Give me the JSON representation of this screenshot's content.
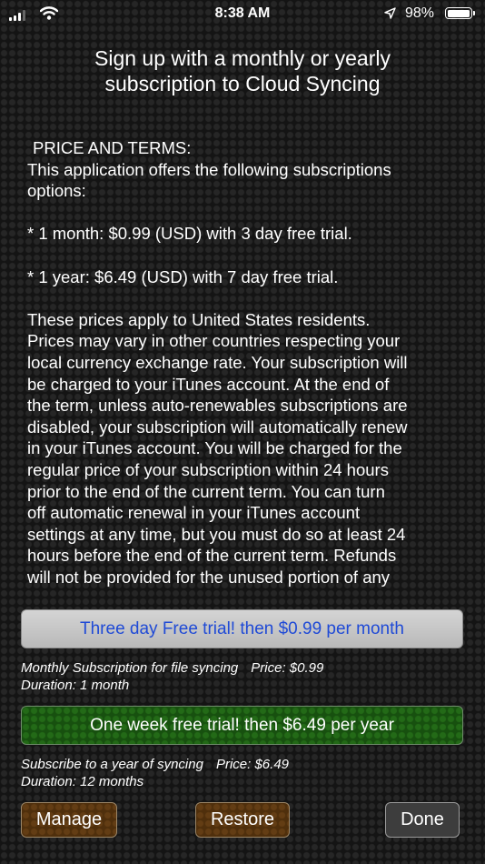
{
  "status_bar": {
    "time": "8:38 AM",
    "battery_percent": "98%",
    "battery_level": 0.98,
    "signal_bars": 4,
    "signal_bars_active": 3,
    "icons": [
      "signal-icon",
      "wifi-icon",
      "location-arrow-icon",
      "battery-icon"
    ]
  },
  "header": {
    "title_line1": "Sign up with a monthly or yearly",
    "title_line2": "subscription to Cloud Syncing"
  },
  "terms": {
    "heading": "PRICE AND TERMS:",
    "intro_line1": "This application offers the following subscriptions",
    "intro_line2": "options:",
    "option_month": "* 1 month: $0.99 (USD) with 3 day free trial.",
    "option_year": "* 1 year: $6.49 (USD) with 7 day free trial.",
    "body_lines": [
      "These prices apply to United States residents.",
      "Prices may vary in other countries respecting your",
      "local currency exchange rate. Your subscription will",
      "be charged to your iTunes account. At the end of",
      "the term, unless auto-renewables subscriptions are",
      "disabled, your subscription will automatically renew",
      "in your iTunes account. You will be charged for the",
      "regular price of your subscription within 24 hours",
      "prior to the end of the current term. You can turn",
      "off automatic renewal in your iTunes account",
      "settings at any time, but you must do so at least 24",
      "hours before the end of the current term. Refunds",
      "will not be provided for the unused portion of any"
    ]
  },
  "monthly": {
    "button_label": "Three day Free trial! then $0.99 per month",
    "description": "Monthly Subscription for file syncing",
    "price": "Price: $0.99",
    "duration": "Duration: 1 month"
  },
  "yearly": {
    "button_label": "One week free trial!  then $6.49 per year",
    "description": "Subscribe to a year of syncing",
    "price": "Price: $6.49",
    "duration": "Duration: 12 months"
  },
  "actions": {
    "manage": "Manage",
    "restore": "Restore",
    "done": "Done"
  },
  "colors": {
    "monthly_button_text": "#1f4ad6",
    "yearly_button_bg": "#17500f",
    "action_button_bg": "#4f2f0c"
  }
}
